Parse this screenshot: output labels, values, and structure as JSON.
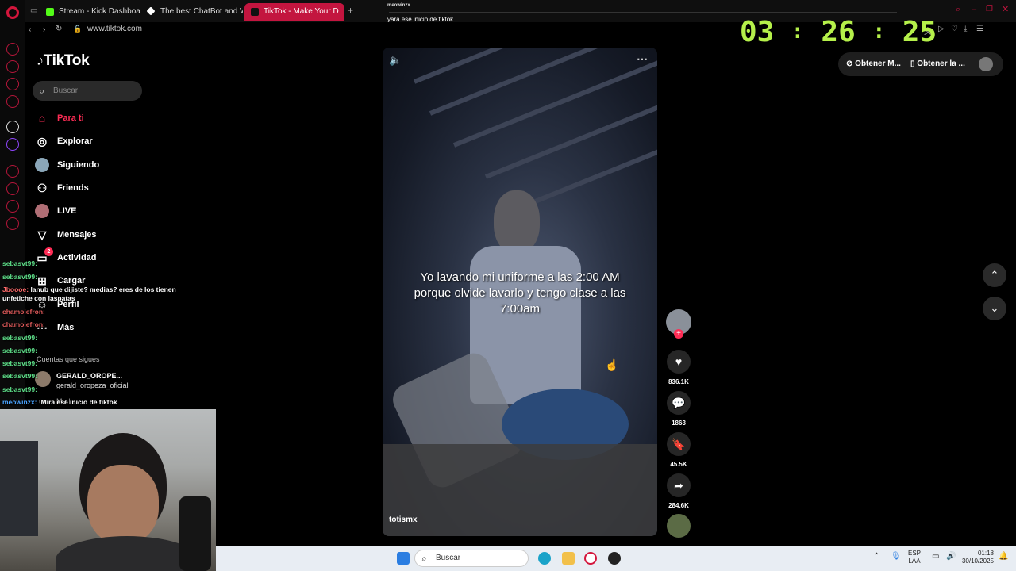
{
  "browser": {
    "tabs": [
      {
        "label": "Stream - Kick Dashboard",
        "color": "#53fc18"
      },
      {
        "label": "The best ChatBot and W",
        "color": "#ffffff"
      },
      {
        "label": "TikTok - Make Your D",
        "color": "#ffffff"
      }
    ],
    "url": "www.tiktok.com"
  },
  "chat_notify": {
    "user": "meowinzx",
    "message": "yara ese inicio de tiktok"
  },
  "timer": {
    "hours": "03",
    "minutes": "26",
    "seconds": "25",
    "sep": ":"
  },
  "tiktok": {
    "brand": "TikTok",
    "search_placeholder": "Buscar",
    "nav": [
      {
        "label": "Para ti",
        "icon": "home-icon",
        "active": true
      },
      {
        "label": "Explorar",
        "icon": "compass-icon"
      },
      {
        "label": "Siguiendo",
        "icon": "avatar-icon"
      },
      {
        "label": "Friends",
        "icon": "friends-icon"
      },
      {
        "label": "LIVE",
        "icon": "live-icon"
      },
      {
        "label": "Mensajes",
        "icon": "send-icon"
      },
      {
        "label": "Actividad",
        "icon": "inbox-icon",
        "badge": "2"
      },
      {
        "label": "Cargar",
        "icon": "upload-icon"
      },
      {
        "label": "Perfil",
        "icon": "profile-icon"
      },
      {
        "label": "Más",
        "icon": "more-icon"
      }
    ],
    "following_heading": "Cuentas que sigues",
    "following": [
      {
        "name": "GERALD_OROPE...",
        "handle": "gerald_oropeza_oficial"
      },
      {
        "name": "Marli..."
      }
    ],
    "header_buttons": [
      "Obtener M...",
      "Obtener la ..."
    ]
  },
  "video": {
    "caption": "Yo lavando mi uniforme a las 2:00 AM porque olvide lavarlo y tengo clase a las 7:00am",
    "author": "totismx_",
    "likes": "836.1K",
    "comments": "1863",
    "saves": "45.5K",
    "shares": "284.6K"
  },
  "chat": [
    {
      "user": "sebasvt99:",
      "text": ""
    },
    {
      "user": "sebasvt99:",
      "text": ""
    },
    {
      "user": "Jboooe:",
      "text": "lanub que dijiste? medias? eres de los tienen"
    },
    {
      "user": "",
      "text": "unfetiche con laspatas"
    },
    {
      "user": "chamoiefron:",
      "text": ""
    },
    {
      "user": "chamoiefron:",
      "text": ""
    },
    {
      "user": "sebasvt99:",
      "text": ""
    },
    {
      "user": "sebasvt99:",
      "text": ""
    },
    {
      "user": "sebasvt99:",
      "text": ""
    },
    {
      "user": "sebasvt99:",
      "text": ""
    },
    {
      "user": "sebasvt99:",
      "text": ""
    },
    {
      "user": "meowinzx:",
      "text": "!Mira ese inicio de tiktok"
    }
  ],
  "taskbar": {
    "search": "Buscar",
    "lang": "ESP",
    "region": "LAA",
    "time": "01:18",
    "date": "30/10/2025"
  }
}
